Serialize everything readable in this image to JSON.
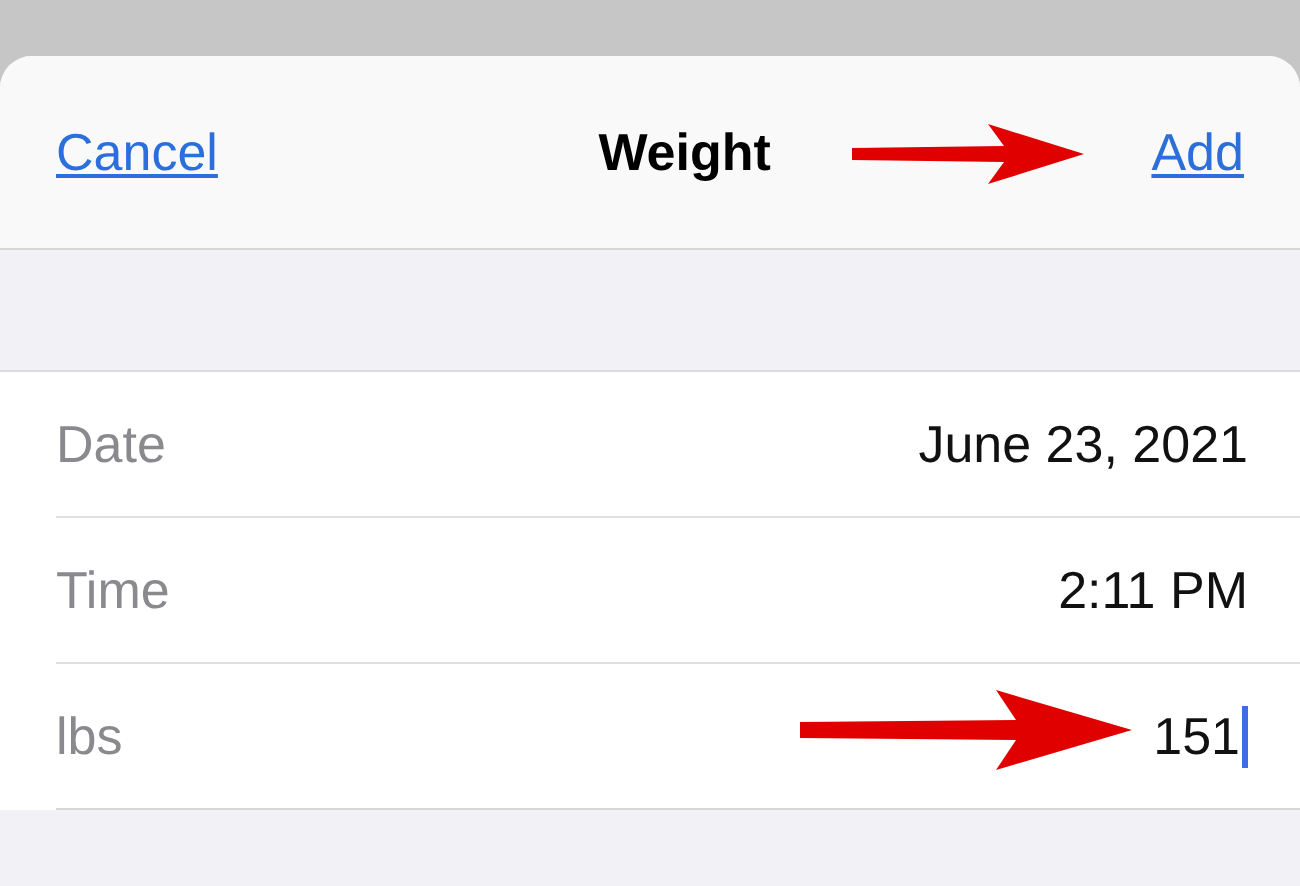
{
  "sheet": {
    "cancel": "Cancel",
    "title": "Weight",
    "add": "Add"
  },
  "fields": [
    {
      "label": "Date",
      "value": "June 23, 2021",
      "editing": false
    },
    {
      "label": "Time",
      "value": "2:11 PM",
      "editing": false
    },
    {
      "label": "lbs",
      "value": "151",
      "editing": true
    }
  ]
}
